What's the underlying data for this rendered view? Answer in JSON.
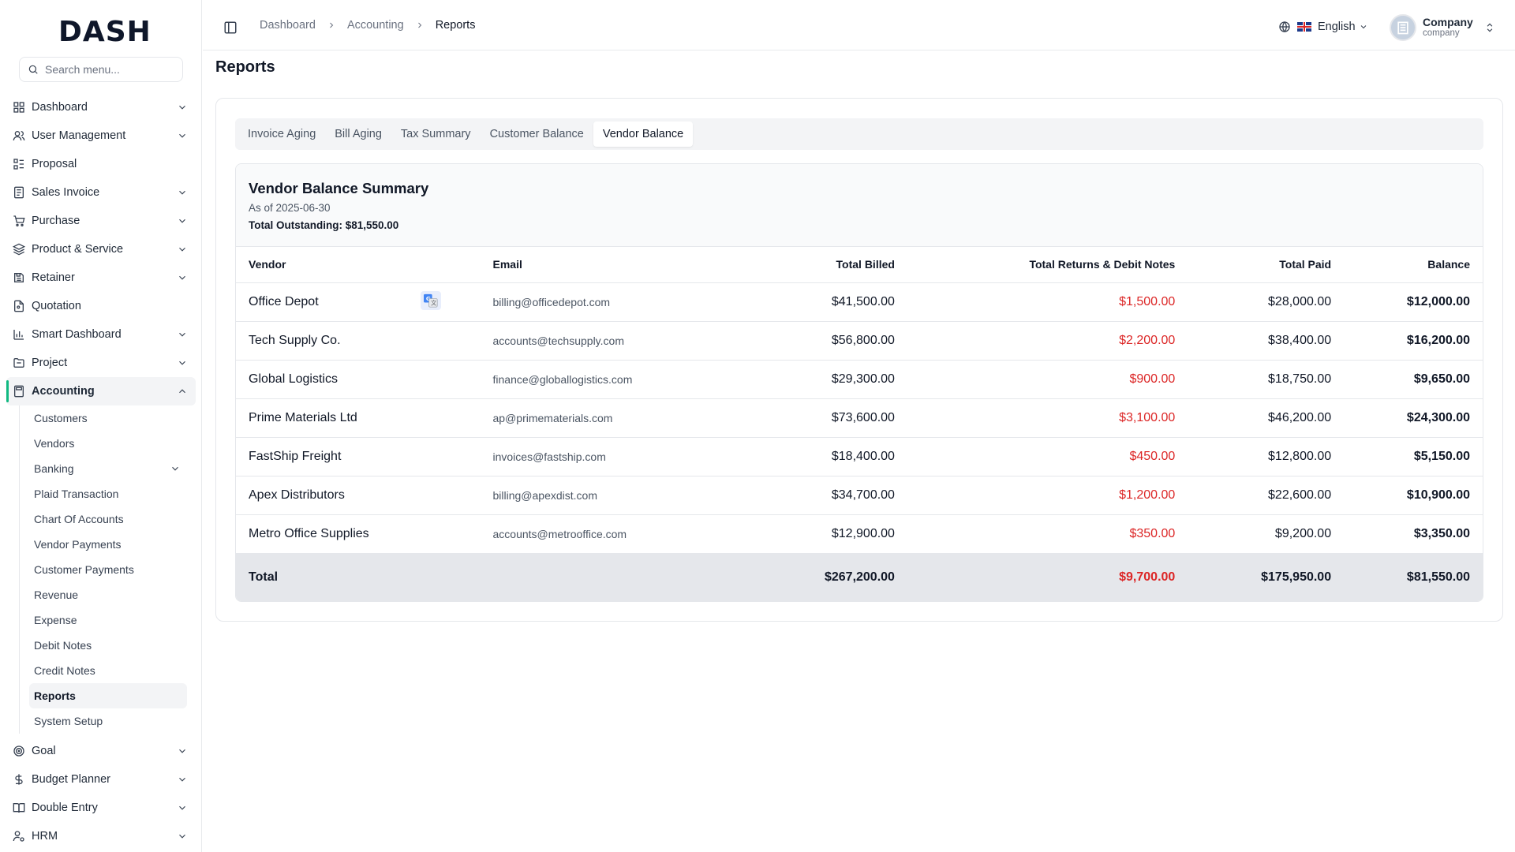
{
  "brand": {
    "logo_text": "DASH"
  },
  "search": {
    "placeholder": "Search menu..."
  },
  "sidebar": {
    "items": [
      {
        "label": "Dashboard",
        "icon": "grid-icon",
        "chevron": true
      },
      {
        "label": "User Management",
        "icon": "users-icon",
        "chevron": true
      },
      {
        "label": "Proposal",
        "icon": "proposal-icon",
        "chevron": false
      },
      {
        "label": "Sales Invoice",
        "icon": "invoice-icon",
        "chevron": true
      },
      {
        "label": "Purchase",
        "icon": "cart-icon",
        "chevron": true
      },
      {
        "label": "Product & Service",
        "icon": "layers-icon",
        "chevron": true
      },
      {
        "label": "Retainer",
        "icon": "retainer-icon",
        "chevron": true
      },
      {
        "label": "Quotation",
        "icon": "file-icon",
        "chevron": false
      },
      {
        "label": "Smart Dashboard",
        "icon": "bar-chart-icon",
        "chevron": true
      },
      {
        "label": "Project",
        "icon": "folder-icon",
        "chevron": true
      },
      {
        "label": "Accounting",
        "icon": "calculator-icon",
        "chevron": true,
        "expanded": true
      },
      {
        "label": "Goal",
        "icon": "target-icon",
        "chevron": true
      },
      {
        "label": "Budget Planner",
        "icon": "dollar-icon",
        "chevron": true
      },
      {
        "label": "Double Entry",
        "icon": "book-icon",
        "chevron": true
      },
      {
        "label": "HRM",
        "icon": "user-cog-icon",
        "chevron": true
      }
    ],
    "accounting_sub": [
      {
        "label": "Customers"
      },
      {
        "label": "Vendors"
      },
      {
        "label": "Banking",
        "chevron": true
      },
      {
        "label": "Plaid Transaction"
      },
      {
        "label": "Chart Of Accounts"
      },
      {
        "label": "Vendor Payments"
      },
      {
        "label": "Customer Payments"
      },
      {
        "label": "Revenue"
      },
      {
        "label": "Expense"
      },
      {
        "label": "Debit Notes"
      },
      {
        "label": "Credit Notes"
      },
      {
        "label": "Reports",
        "active": true
      },
      {
        "label": "System Setup"
      }
    ]
  },
  "header": {
    "breadcrumb": [
      "Dashboard",
      "Accounting",
      "Reports"
    ],
    "language": "English",
    "company_name": "Company",
    "company_role": "company"
  },
  "page": {
    "title": "Reports"
  },
  "tabs": [
    {
      "label": "Invoice Aging",
      "active": false
    },
    {
      "label": "Bill Aging",
      "active": false
    },
    {
      "label": "Tax Summary",
      "active": false
    },
    {
      "label": "Customer Balance",
      "active": false
    },
    {
      "label": "Vendor Balance",
      "active": true
    }
  ],
  "report": {
    "title": "Vendor Balance Summary",
    "as_of": "As of 2025-06-30",
    "total_outstanding": "Total Outstanding: $81,550.00",
    "columns": [
      "Vendor",
      "Email",
      "Total Billed",
      "Total Returns & Debit Notes",
      "Total Paid",
      "Balance"
    ],
    "rows": [
      {
        "vendor": "Office Depot",
        "email": "billing@officedepot.com",
        "billed": "$41,500.00",
        "returns": "$1,500.00",
        "paid": "$28,000.00",
        "balance": "$12,000.00"
      },
      {
        "vendor": "Tech Supply Co.",
        "email": "accounts@techsupply.com",
        "billed": "$56,800.00",
        "returns": "$2,200.00",
        "paid": "$38,400.00",
        "balance": "$16,200.00"
      },
      {
        "vendor": "Global Logistics",
        "email": "finance@globallogistics.com",
        "billed": "$29,300.00",
        "returns": "$900.00",
        "paid": "$18,750.00",
        "balance": "$9,650.00"
      },
      {
        "vendor": "Prime Materials Ltd",
        "email": "ap@primematerials.com",
        "billed": "$73,600.00",
        "returns": "$3,100.00",
        "paid": "$46,200.00",
        "balance": "$24,300.00"
      },
      {
        "vendor": "FastShip Freight",
        "email": "invoices@fastship.com",
        "billed": "$18,400.00",
        "returns": "$450.00",
        "paid": "$12,800.00",
        "balance": "$5,150.00"
      },
      {
        "vendor": "Apex Distributors",
        "email": "billing@apexdist.com",
        "billed": "$34,700.00",
        "returns": "$1,200.00",
        "paid": "$22,600.00",
        "balance": "$10,900.00"
      },
      {
        "vendor": "Metro Office Supplies",
        "email": "accounts@metrooffice.com",
        "billed": "$12,900.00",
        "returns": "$350.00",
        "paid": "$9,200.00",
        "balance": "$3,350.00"
      }
    ],
    "total": {
      "label": "Total",
      "billed": "$267,200.00",
      "returns": "$9,700.00",
      "paid": "$175,950.00",
      "balance": "$81,550.00"
    }
  },
  "colors": {
    "accent": "#10b981",
    "negative": "#dc2626",
    "total_row_bg": "#e5e7eb"
  }
}
